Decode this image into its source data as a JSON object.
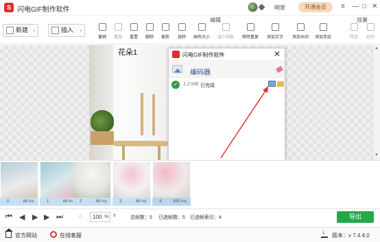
{
  "app": {
    "title": "闪电GIF制作软件",
    "username": "啊翠",
    "vip_label": "开通会员"
  },
  "window_controls": {
    "menu": "≡",
    "minimize": "—",
    "maximize": "□",
    "close": "✕"
  },
  "toolbar": {
    "new_label": "新建",
    "insert_label": "插入",
    "edit_group_label": "编辑",
    "effect_group_label": "效果",
    "tools": [
      "撤销",
      "重做",
      "重置",
      "删除",
      "裁剪",
      "旋转",
      "画布大小",
      "减少帧数",
      "移除重复",
      "添加文字",
      "添加水印",
      "添加手绘"
    ],
    "effects": [
      "特效",
      "延时"
    ]
  },
  "canvas": {
    "frame_caption": "花朵1"
  },
  "dialog": {
    "title": "闪电GIF制作软件",
    "close": "✕",
    "encoder_title": "编码器",
    "file_size": "1.2 MB",
    "status": "已完成",
    "check": "✓"
  },
  "filmstrip": {
    "frames": [
      {
        "index": "0",
        "duration": "66 ms"
      },
      {
        "index": "1",
        "duration": "66 ms"
      },
      {
        "index": "2",
        "duration": "66 ms"
      },
      {
        "index": "3",
        "duration": "66 ms"
      },
      {
        "index": "4",
        "duration": "650 ms"
      }
    ]
  },
  "player": {
    "zoom": "100",
    "zoom_unit": "%",
    "total_frames": "总帧数：5",
    "selected_frames": "已选帧数：5",
    "selected_index": "已选帧索引：4",
    "export_label": "导出"
  },
  "statusbar": {
    "website": "官方网站",
    "service": "在线客服",
    "version": "版本：v 7.4.4.0"
  },
  "colors": {
    "brand_red": "#d9302c",
    "export_green": "#27a74a",
    "annotation_red": "#e0312b",
    "frame_bar": "#c7dff3"
  }
}
